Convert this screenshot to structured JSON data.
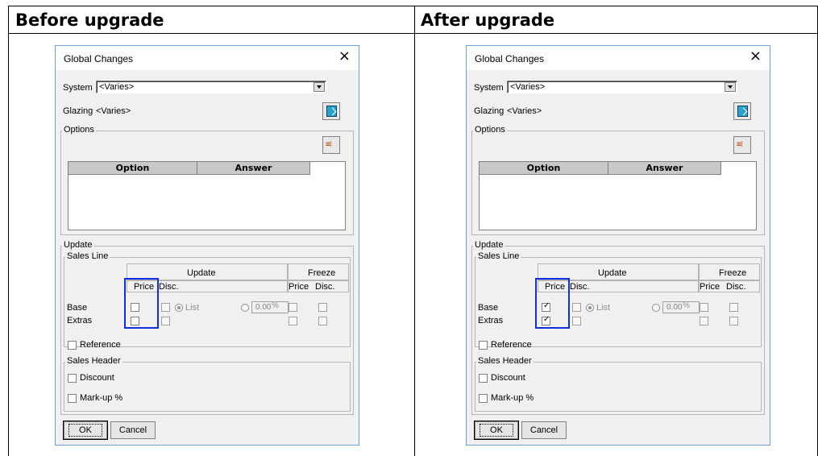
{
  "headers": {
    "before": "Before upgrade",
    "after": "After upgrade"
  },
  "dialog": {
    "title": "Global Changes",
    "close_symbol": "×",
    "system_label": "System",
    "system_value": "<Varies>",
    "glazing_label": "Glazing",
    "glazing_value": "<Varies>",
    "options_group": "Options",
    "option_col": "Option",
    "answer_col": "Answer",
    "update_group": "Update",
    "sales_line_group": "Sales Line",
    "update_col": "Update",
    "freeze_col": "Freeze",
    "price": "Price",
    "disc": "Disc.",
    "base": "Base",
    "extras": "Extras",
    "list": "List",
    "pct_value": "0.00",
    "pct_sign": "%",
    "reference": "Reference",
    "sales_header_group": "Sales Header",
    "discount": "Discount",
    "markup": "Mark-up %",
    "ok": "OK",
    "cancel": "Cancel",
    "icons": [
      "glazing-icon",
      "options-icon",
      "chevron-down-icon",
      "close-icon"
    ]
  },
  "states": {
    "before": {
      "base_price_checked": false,
      "extras_price_checked": false
    },
    "after": {
      "base_price_checked": true,
      "extras_price_checked": true
    }
  },
  "colors": {
    "highlight": "#1030e0",
    "dialog_border": "#6f9fd8"
  }
}
